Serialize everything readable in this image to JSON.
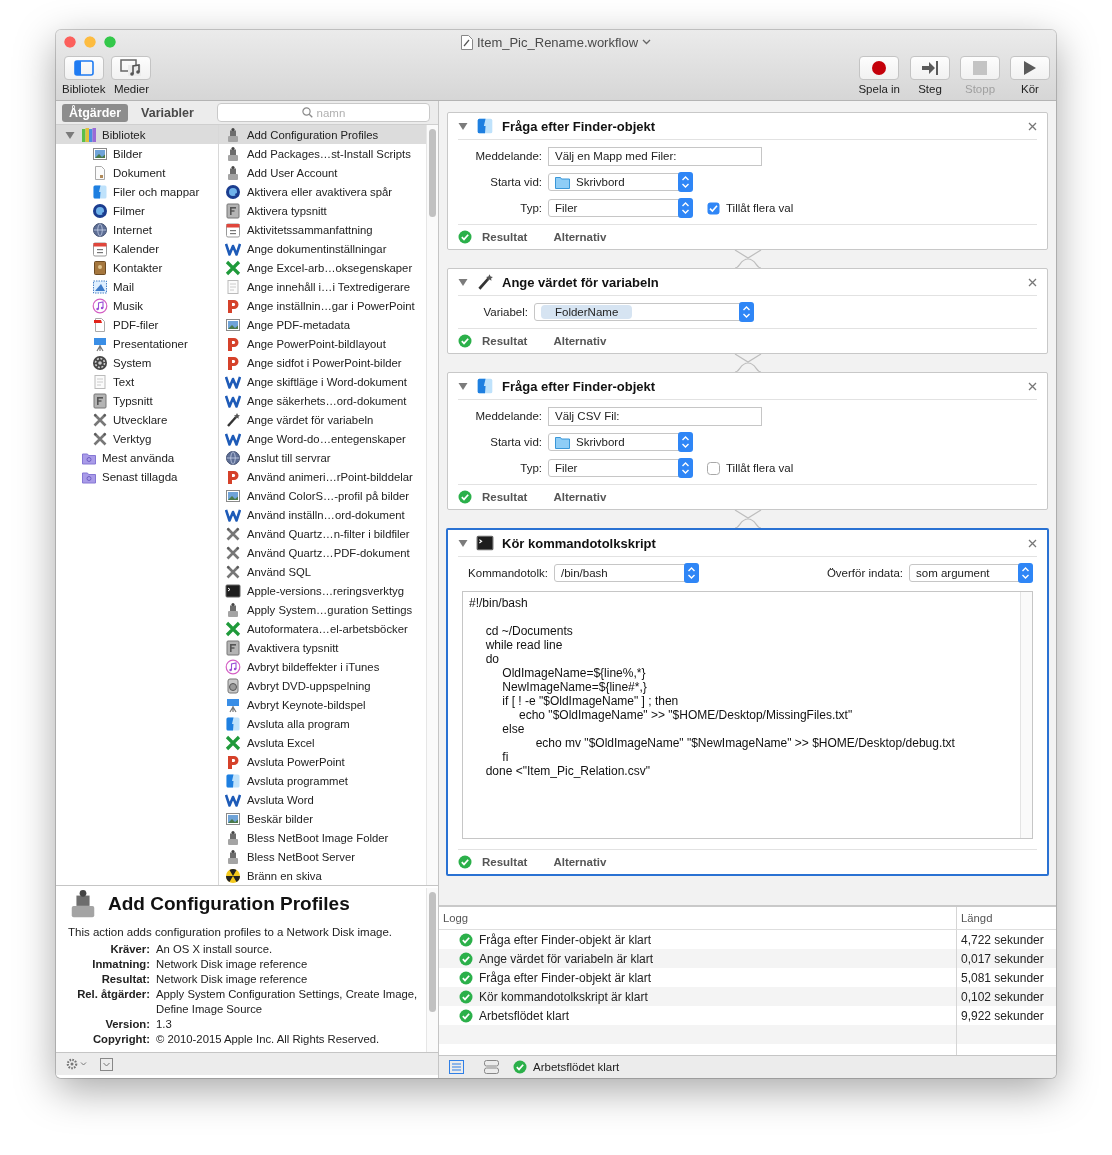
{
  "window": {
    "title": "Item_Pic_Rename.workflow"
  },
  "toolbar_left": [
    {
      "label": "Bibliotek",
      "kind": "library"
    },
    {
      "label": "Medier",
      "kind": "media"
    }
  ],
  "toolbar_right": [
    {
      "label": "Spela in",
      "kind": "record",
      "disabled": false
    },
    {
      "label": "Steg",
      "kind": "step",
      "disabled": false
    },
    {
      "label": "Stopp",
      "kind": "stop",
      "disabled": true
    },
    {
      "label": "Kör",
      "kind": "run",
      "disabled": false
    }
  ],
  "tabs": [
    {
      "label": "Åtgärder",
      "selected": true
    },
    {
      "label": "Variabler",
      "selected": false
    }
  ],
  "search": {
    "placeholder": "namn"
  },
  "library": [
    {
      "label": "Bibliotek",
      "kind": "library",
      "selected": true,
      "expanded": true,
      "children": [
        {
          "label": "Bilder",
          "kind": "preview",
          "selected": false
        },
        {
          "label": "Dokument",
          "kind": "doc",
          "selected": false
        },
        {
          "label": "Filer och mappar",
          "kind": "finder",
          "selected": false
        },
        {
          "label": "Filmer",
          "kind": "quicktime",
          "selected": false
        },
        {
          "label": "Internet",
          "kind": "globe",
          "selected": false
        },
        {
          "label": "Kalender",
          "kind": "calendar",
          "selected": false
        },
        {
          "label": "Kontakter",
          "kind": "contacts",
          "selected": false
        },
        {
          "label": "Mail",
          "kind": "mail",
          "selected": false
        },
        {
          "label": "Musik",
          "kind": "music",
          "selected": false
        },
        {
          "label": "PDF-filer",
          "kind": "pdf",
          "selected": false
        },
        {
          "label": "Presentationer",
          "kind": "keynote",
          "selected": false
        },
        {
          "label": "System",
          "kind": "system",
          "selected": false
        },
        {
          "label": "Text",
          "kind": "textedit",
          "selected": false
        },
        {
          "label": "Typsnitt",
          "kind": "font",
          "selected": false
        },
        {
          "label": "Utvecklare",
          "kind": "tools",
          "selected": false
        },
        {
          "label": "Verktyg",
          "kind": "tools",
          "selected": false
        }
      ]
    },
    {
      "label": "Mest använda",
      "kind": "smartfolder",
      "selected": false
    },
    {
      "label": "Senast tillagda",
      "kind": "smartfolder",
      "selected": false
    }
  ],
  "actions": [
    {
      "label": "Add Configuration Profiles",
      "kind": "robot",
      "selected": true
    },
    {
      "label": "Add Packages…st-Install Scripts",
      "kind": "robot",
      "selected": false
    },
    {
      "label": "Add User Account",
      "kind": "robot",
      "selected": false
    },
    {
      "label": "Aktivera eller avaktivera spår",
      "kind": "quicktime",
      "selected": false
    },
    {
      "label": "Aktivera typsnitt",
      "kind": "font",
      "selected": false
    },
    {
      "label": "Aktivitetssammanfattning",
      "kind": "calendar",
      "selected": false
    },
    {
      "label": "Ange dokumentinställningar",
      "kind": "word",
      "selected": false
    },
    {
      "label": "Ange Excel-arb…oksegenskaper",
      "kind": "excel",
      "selected": false
    },
    {
      "label": "Ange innehåll i…i Textredigerare",
      "kind": "textedit",
      "selected": false
    },
    {
      "label": "Ange inställnin…gar i PowerPoint",
      "kind": "powerpoint",
      "selected": false
    },
    {
      "label": "Ange PDF-metadata",
      "kind": "preview",
      "selected": false
    },
    {
      "label": "Ange PowerPoint-bildlayout",
      "kind": "powerpoint",
      "selected": false
    },
    {
      "label": "Ange sidfot i PowerPoint-bilder",
      "kind": "powerpoint",
      "selected": false
    },
    {
      "label": "Ange skiftläge i Word-dokument",
      "kind": "word",
      "selected": false
    },
    {
      "label": "Ange säkerhets…ord-dokument",
      "kind": "word",
      "selected": false
    },
    {
      "label": "Ange värdet för variabeln",
      "kind": "variable",
      "selected": false
    },
    {
      "label": "Ange Word-do…entegenskaper",
      "kind": "word",
      "selected": false
    },
    {
      "label": "Anslut till servrar",
      "kind": "globe",
      "selected": false
    },
    {
      "label": "Använd animeri…rPoint-bilddelar",
      "kind": "powerpoint",
      "selected": false
    },
    {
      "label": "Använd ColorS…-profil på bilder",
      "kind": "preview",
      "selected": false
    },
    {
      "label": "Använd inställn…ord-dokument",
      "kind": "word",
      "selected": false
    },
    {
      "label": "Använd Quartz…n-filter i bildfiler",
      "kind": "tools",
      "selected": false
    },
    {
      "label": "Använd Quartz…PDF-dokument",
      "kind": "tools",
      "selected": false
    },
    {
      "label": "Använd SQL",
      "kind": "tools",
      "selected": false
    },
    {
      "label": "Apple-versions…reringsverktyg",
      "kind": "terminal",
      "selected": false
    },
    {
      "label": "Apply System…guration Settings",
      "kind": "robot",
      "selected": false
    },
    {
      "label": "Autoformatera…el-arbetsböcker",
      "kind": "excel",
      "selected": false
    },
    {
      "label": "Avaktivera typsnitt",
      "kind": "font",
      "selected": false
    },
    {
      "label": "Avbryt bildeffekter i iTunes",
      "kind": "music",
      "selected": false
    },
    {
      "label": "Avbryt DVD-uppspelning",
      "kind": "dvd",
      "selected": false
    },
    {
      "label": "Avbryt Keynote-bildspel",
      "kind": "keynote",
      "selected": false
    },
    {
      "label": "Avsluta alla program",
      "kind": "finder",
      "selected": false
    },
    {
      "label": "Avsluta Excel",
      "kind": "excel",
      "selected": false
    },
    {
      "label": "Avsluta PowerPoint",
      "kind": "powerpoint",
      "selected": false
    },
    {
      "label": "Avsluta programmet",
      "kind": "finder",
      "selected": false
    },
    {
      "label": "Avsluta Word",
      "kind": "word",
      "selected": false
    },
    {
      "label": "Beskär bilder",
      "kind": "preview",
      "selected": false
    },
    {
      "label": "Bless NetBoot Image Folder",
      "kind": "robot",
      "selected": false
    },
    {
      "label": "Bless NetBoot Server",
      "kind": "robot",
      "selected": false
    },
    {
      "label": "Bränn en skiva",
      "kind": "burn",
      "selected": false
    }
  ],
  "description": {
    "title": "Add Configuration Profiles",
    "text": "This action adds configuration profiles to a Network Disk image.",
    "info": [
      {
        "label": "Kräver:",
        "value": "An OS X install source."
      },
      {
        "label": "Inmatning:",
        "value": "Network Disk image reference"
      },
      {
        "label": "Resultat:",
        "value": "Network Disk image reference"
      },
      {
        "label": "Rel. åtgärder:",
        "value": "Apply System Configuration Settings, Create Image, Define Image Source"
      },
      {
        "label": "Version:",
        "value": "1.3"
      },
      {
        "label": "Copyright:",
        "value": "© 2010-2015 Apple Inc. All Rights Reserved."
      }
    ]
  },
  "workflow": [
    {
      "title": "Fråga efter Finder-objekt",
      "kind": "finder",
      "expanded": true,
      "selected": false,
      "fields": [
        {
          "kind": "text",
          "label": "Meddelande:",
          "value": "Välj en Mapp med Filer:"
        },
        {
          "kind": "folder_popup",
          "label": "Starta vid:",
          "value": "Skrivbord"
        },
        {
          "kind": "popup",
          "label": "Typ:",
          "value": "Filer",
          "checkbox": {
            "label": "Tillåt flera val",
            "checked": true
          }
        }
      ],
      "footer": {
        "result": "Resultat",
        "options": "Alternativ"
      }
    },
    {
      "title": "Ange värdet för variabeln",
      "kind": "variable",
      "expanded": true,
      "selected": false,
      "fields": [
        {
          "kind": "token_popup",
          "label": "Variabel:",
          "value": "FolderName"
        }
      ],
      "footer": {
        "result": "Resultat",
        "options": "Alternativ"
      }
    },
    {
      "title": "Fråga efter Finder-objekt",
      "kind": "finder",
      "expanded": true,
      "selected": false,
      "fields": [
        {
          "kind": "text",
          "label": "Meddelande:",
          "value": "Välj CSV Fil:"
        },
        {
          "kind": "folder_popup",
          "label": "Starta vid:",
          "value": "Skrivbord"
        },
        {
          "kind": "popup",
          "label": "Typ:",
          "value": "Filer",
          "checkbox": {
            "label": "Tillåt flera val",
            "checked": false
          }
        }
      ],
      "footer": {
        "result": "Resultat",
        "options": "Alternativ"
      }
    },
    {
      "title": "Kör kommandotolkskript",
      "kind": "terminal",
      "expanded": true,
      "selected": true,
      "fields": [
        {
          "kind": "split",
          "label": "Kommandotolk:",
          "value": "/bin/bash",
          "label_2": "Överför indata:",
          "value_2": "som argument"
        }
      ],
      "script": "#!/bin/bash\n\n     cd ~/Documents\n     while read line\n     do\n          OldImageName=${line%,*}\n          NewImageName=${line#*,}\n          if [ ! -e \"$OldImageName\" ] ; then\n               echo \"$OldImageName\" >> \"$HOME/Desktop/MissingFiles.txt\"\n          else\n                    echo mv \"$OldImageName\" \"$NewImageName\" >> $HOME/Desktop/debug.txt\n          fi\n     done <\"Item_Pic_Relation.csv\"",
      "footer": {
        "result": "Resultat",
        "options": "Alternativ"
      }
    }
  ],
  "log": {
    "columns": [
      "Logg",
      "Längd"
    ],
    "rows": [
      {
        "message": "Fråga efter Finder-objekt är klart",
        "duration": "4,722 sekunder",
        "done": true
      },
      {
        "message": "Ange värdet för variabeln är klart",
        "duration": "0,017 sekunder",
        "done": true
      },
      {
        "message": "Fråga efter Finder-objekt är klart",
        "duration": "5,081 sekunder",
        "done": true
      },
      {
        "message": "Kör kommandotolkskript är klart",
        "duration": "0,102 sekunder",
        "done": true
      },
      {
        "message": "Arbetsflödet klart",
        "duration": "9,922 sekunder",
        "done": true
      }
    ]
  },
  "status_bar": {
    "text": "Arbetsflödet klart",
    "done": true
  }
}
